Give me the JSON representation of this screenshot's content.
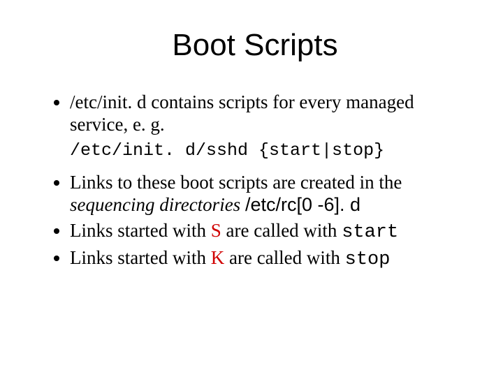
{
  "title": "Boot Scripts",
  "bullet1": {
    "text_a": "/etc/init. d contains scripts for every managed service, e. g.",
    "code": "/etc/init. d/sshd {start|stop}"
  },
  "bullet2": {
    "text_a": "Links to these boot scripts are created in the ",
    "em": "sequencing directories ",
    "sans": "/etc/rc[0 -6]. d"
  },
  "bullet3": {
    "text_a": "Links started with ",
    "s": "S",
    "text_b": " are called with ",
    "code": "start"
  },
  "bullet4": {
    "text_a": "Links started with ",
    "k": "K",
    "text_b": " are called with ",
    "code": "stop"
  }
}
